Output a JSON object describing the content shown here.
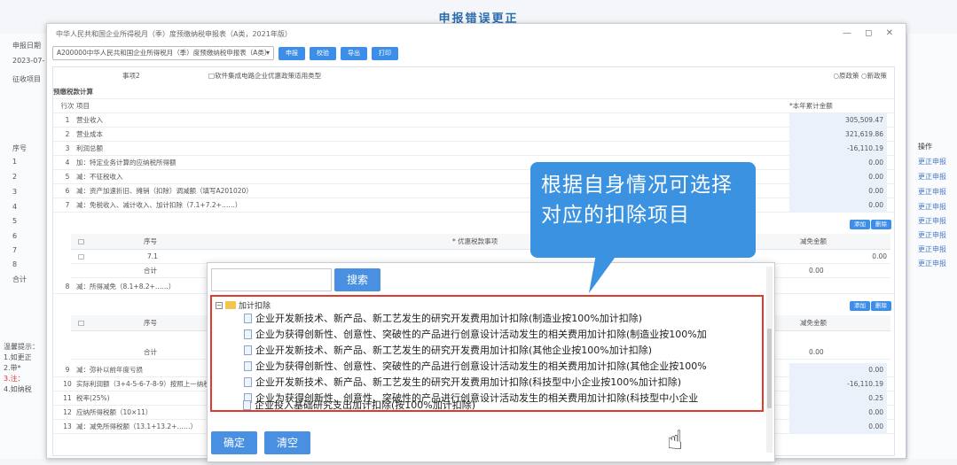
{
  "page_title": "申报错误更正",
  "left_labels": [
    "申报日期",
    "2023-07-",
    "征收项目",
    "序号",
    "1",
    "2",
    "3",
    "4",
    "5",
    "6",
    "7",
    "8",
    "合计",
    "温馨提示：",
    "1.如更正",
    "2.带*",
    "3.注：",
    "4.如纳税"
  ],
  "right_header": "操作",
  "right_links": [
    "更正申报",
    "更正申报",
    "更正申报",
    "更正申报",
    "更正申报",
    "更正申报",
    "更正申报",
    "更正申报"
  ],
  "modal": {
    "title": "中华人民共和国企业所得税月（季）度预缴纳税申报表（A类，2021年版）",
    "form_select": "A200000中华人民共和国企业所得税月（季）度预缴纳税申报表（A类）",
    "buttons": [
      "申报",
      "校验",
      "导出",
      "打印"
    ],
    "row_label": "事项2",
    "row_option": "□软件集成电路企业优惠政策适用类型",
    "row_right": "○原政策  ○新政策",
    "section": "预缴税款计算",
    "col_no": "行次",
    "col_item": "项目",
    "col_amount": "*本年累计金额"
  },
  "rows": [
    {
      "no": "1",
      "item": "营业收入",
      "val": "305,509.47"
    },
    {
      "no": "2",
      "item": "营业成本",
      "val": "321,619.86"
    },
    {
      "no": "3",
      "item": "利润总额",
      "val": "-16,110.19"
    },
    {
      "no": "4",
      "item": "加：特定业务计算的应纳税所得额",
      "val": "0.00"
    },
    {
      "no": "5",
      "item": "减：不征税收入",
      "val": "0.00"
    },
    {
      "no": "6",
      "item": "减：资产加速折旧、摊销（扣除）调减额（填写A201020）",
      "val": "0.00"
    },
    {
      "no": "7",
      "item": "减：免税收入、减计收入、加计扣除（7.1+7.2+……）",
      "val": "0.00"
    }
  ],
  "sub": {
    "btn_add": "添加",
    "btn_del": "删除",
    "col_seq": "序号",
    "col_matter": "* 优惠税款事项",
    "col_amount": "减免金额",
    "r71": "7.1",
    "r71_val": "0.00",
    "subtotal": "合计",
    "sub_val": "0.00"
  },
  "row8": {
    "no": "8",
    "item": "减：所得减免（8.1+8.2+……）"
  },
  "lower_rows": [
    {
      "no": "9",
      "item": "减：弥补以前年度亏损",
      "val": "0.00"
    },
    {
      "no": "10",
      "item": "实际利润额（3+4-5-6-7-8-9）按照上一纳税年",
      "val": "-16,110.19"
    },
    {
      "no": "11",
      "item": "税率(25%)",
      "val": "0.25"
    },
    {
      "no": "12",
      "item": "应纳所得税额（10×11）",
      "val": "0.00"
    },
    {
      "no": "13",
      "item": "减：减免所得税额（13.1+13.2+……）",
      "val": "0.00"
    }
  ],
  "popup": {
    "search_placeholder": "",
    "search_label": "搜索",
    "root_label": "加计扣除",
    "items": [
      "企业开发新技术、新产品、新工艺发生的研究开发费用加计扣除(制造业按100%加计扣除)",
      "企业为获得创新性、创意性、突破性的产品进行创意设计活动发生的相关费用加计扣除(制造业按100%加",
      "企业开发新技术、新产品、新工艺发生的研究开发费用加计扣除(其他企业按100%加计扣除)",
      "企业为获得创新性、创意性、突破性的产品进行创意设计活动发生的相关费用加计扣除(其他企业按100%",
      "企业开发新技术、新产品、新工艺发生的研究开发费用加计扣除(科技型中小企业按100%加计扣除)",
      "企业为获得创新性、创意性、突破性的产品进行创意设计活动发生的相关费用加计扣除(科技型中小企业",
      "企业投入基础研究支出加计扣除(按100%加计扣除)"
    ],
    "ok_label": "确定",
    "clear_label": "清空"
  },
  "callout": "根据自身情况可选择对应的扣除项目",
  "colors": {
    "accent": "#3d8ee8",
    "highlight": "#e03a2f",
    "callout": "#3a92e0"
  }
}
